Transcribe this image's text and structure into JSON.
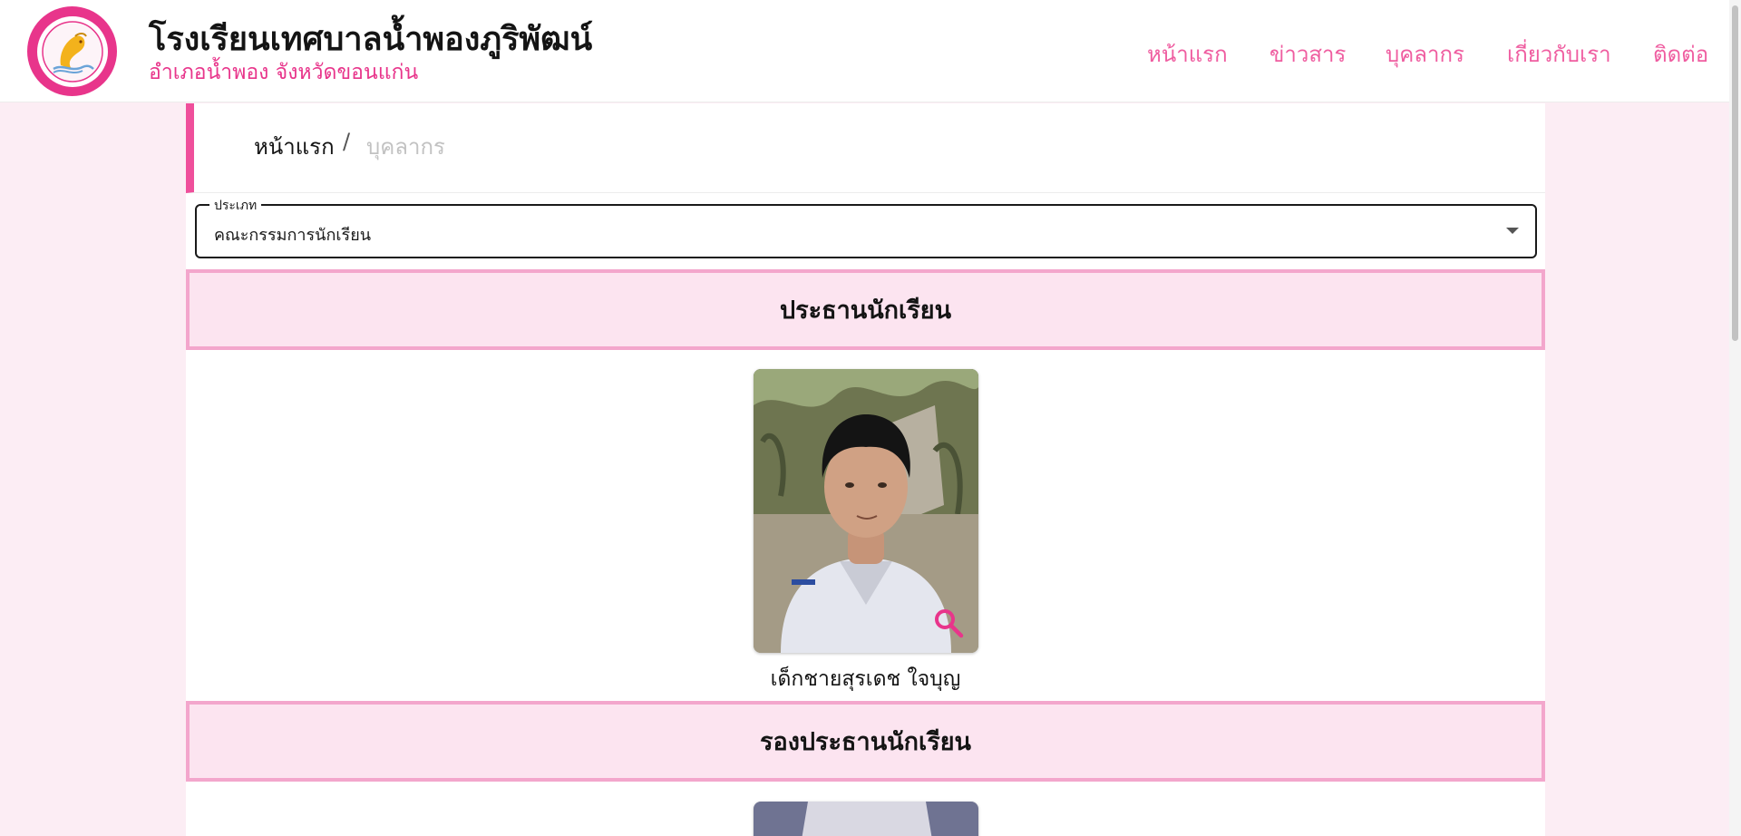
{
  "header": {
    "school_name": "โรงเรียนเทศบาลน้ำพองภูริพัฒน์",
    "school_subtitle": "อำเภอน้ำพอง จังหวัดขอนแก่น",
    "nav": [
      {
        "label": "หน้าแรก"
      },
      {
        "label": "ข่าวสาร"
      },
      {
        "label": "บุคลากร"
      },
      {
        "label": "เกี่ยวกับเรา"
      },
      {
        "label": "ติดต่อ"
      }
    ]
  },
  "breadcrumb": {
    "home": "หน้าแรก",
    "separator": "/",
    "current": "บุคลากร"
  },
  "filter": {
    "label": "ประเภท",
    "selected": "คณะกรรมการนักเรียน"
  },
  "sections": [
    {
      "title": "ประธานนักเรียน",
      "members": [
        {
          "name": "เด็กชายสุรเดช ใจบุญ"
        }
      ]
    },
    {
      "title": "รองประธานนักเรียน",
      "members": [
        {
          "name": ""
        }
      ]
    }
  ],
  "colors": {
    "brand_pink": "#e8358b",
    "nav_pink": "#ef5da0",
    "section_bg": "#fce4f0",
    "section_border": "#f3a6cc",
    "page_bg": "#fcedf4"
  },
  "icons": {
    "logo": "school-emblem-icon",
    "zoom": "magnify-icon",
    "dropdown": "chevron-down-icon"
  }
}
